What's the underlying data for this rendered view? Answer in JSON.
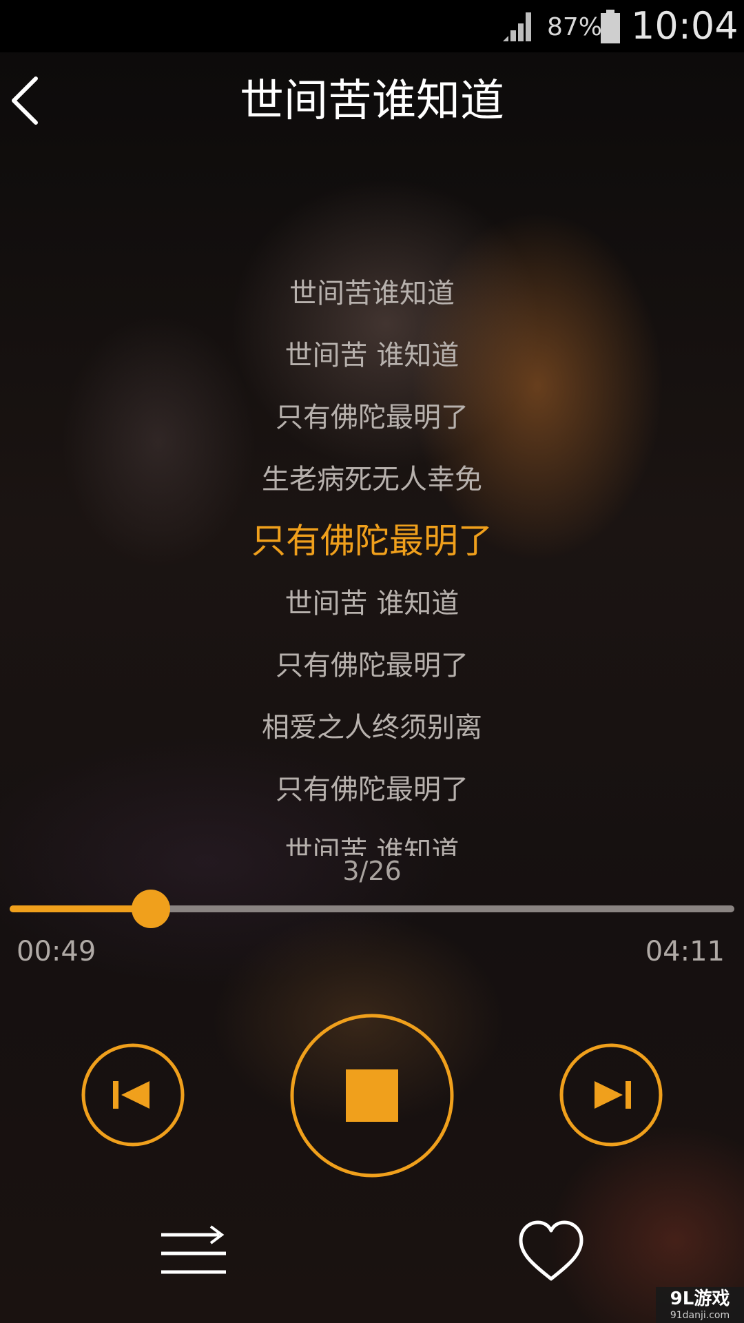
{
  "status_bar": {
    "battery_percent": "87%",
    "time": "10:04",
    "icons": [
      "signal-icon",
      "battery-icon"
    ]
  },
  "header": {
    "title": "世间苦谁知道",
    "back_icon": "back-arrow-icon"
  },
  "lyrics": {
    "lines": [
      "世间苦谁知道",
      "世间苦 谁知道",
      "只有佛陀最明了",
      "生老病死无人幸免",
      "只有佛陀最明了",
      "世间苦 谁知道",
      "只有佛陀最明了",
      "相爱之人终须别离",
      "只有佛陀最明了",
      "世间苦 谁知道"
    ],
    "active_index": 4,
    "page_indicator": "3/26"
  },
  "progress": {
    "elapsed": "00:49",
    "total": "04:11",
    "fraction": 0.195
  },
  "controls": {
    "icons": [
      "skip-previous-icon",
      "stop-icon",
      "skip-next-icon",
      "playlist-icon",
      "heart-icon"
    ]
  },
  "colors": {
    "accent": "#f0a01c",
    "lyric": "#b7b1ad",
    "title": "#ffffff"
  },
  "watermark": {
    "logo": "9L游戏",
    "domain": "91danji.com"
  }
}
